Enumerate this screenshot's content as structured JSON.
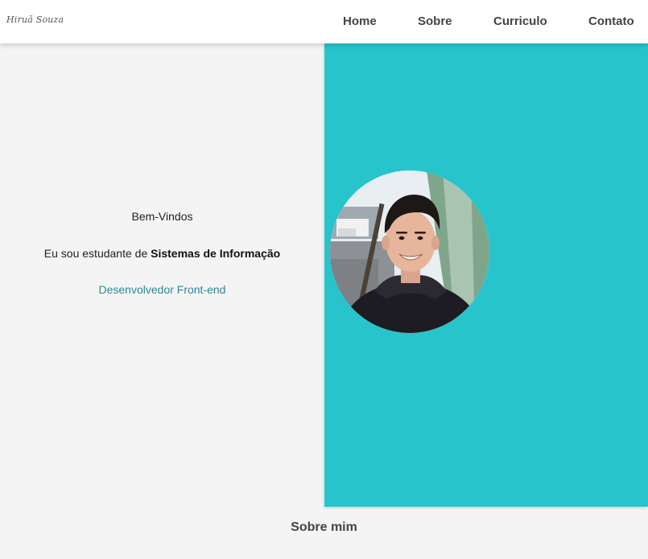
{
  "brand": {
    "logo_text": "Hiruã Souza"
  },
  "nav": {
    "home": "Home",
    "sobre": "Sobre",
    "curriculo": "Curriculo",
    "contato": "Contato"
  },
  "hero": {
    "greeting": "Bem-Vindos",
    "intro_prefix": "Eu sou estudante de ",
    "intro_highlight": "Sistemas de Informação",
    "role": "Desenvolvedor Front-end",
    "avatar_alt": "profile-photo"
  },
  "sections": {
    "about_title": "Sobre mim"
  },
  "colors": {
    "accent": "#28c4cc",
    "role_text": "#2a8a96",
    "background": "#f4f4f4",
    "nav_text": "#444444"
  }
}
